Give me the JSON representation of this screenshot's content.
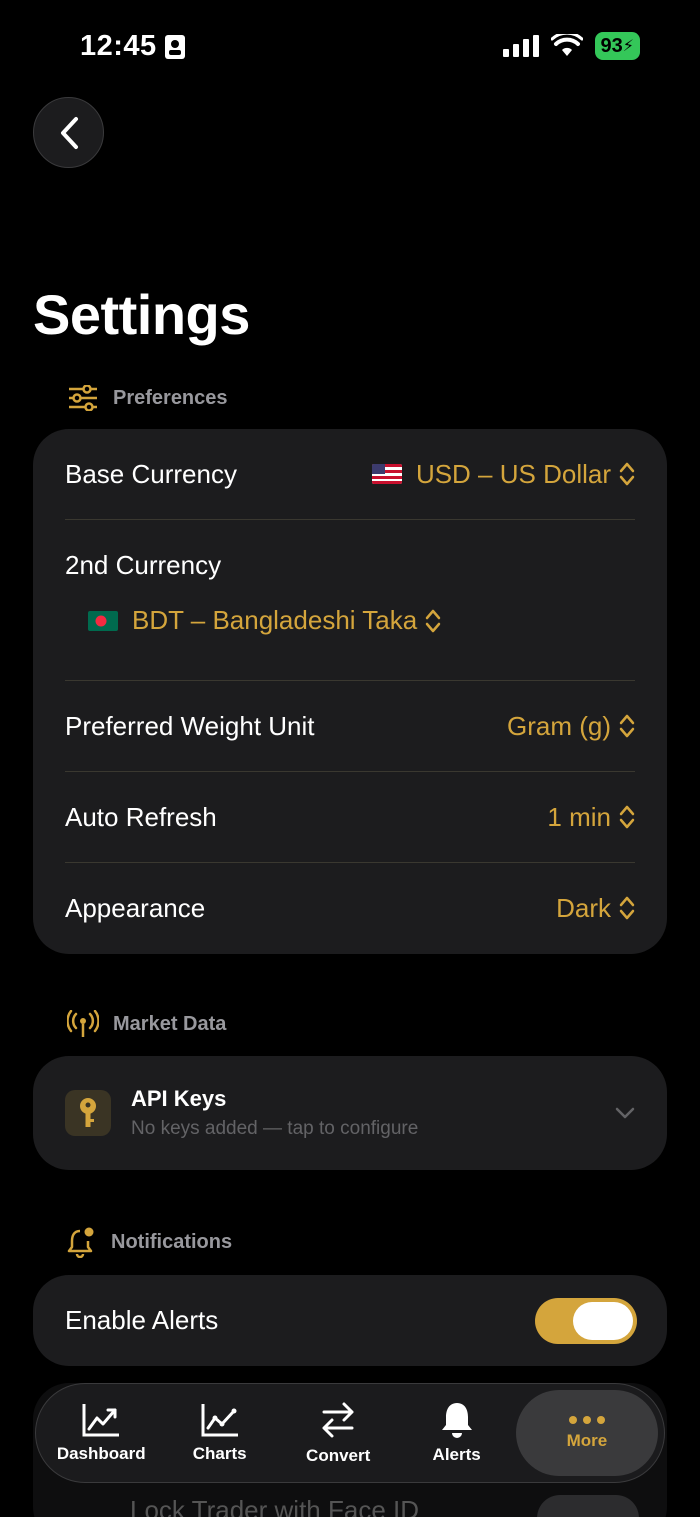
{
  "status": {
    "time": "12:45",
    "battery": "93"
  },
  "page": {
    "title": "Settings"
  },
  "sections": {
    "preferences": "Preferences",
    "market_data": "Market Data",
    "notifications": "Notifications"
  },
  "preferences": {
    "base_currency_label": "Base Currency",
    "base_currency_value": "USD – US Dollar",
    "second_currency_label": "2nd Currency",
    "second_currency_value": "BDT – Bangladeshi Taka",
    "weight_label": "Preferred Weight Unit",
    "weight_value": "Gram (g)",
    "refresh_label": "Auto Refresh",
    "refresh_value": "1 min",
    "appearance_label": "Appearance",
    "appearance_value": "Dark"
  },
  "market": {
    "api_title": "API Keys",
    "api_subtitle": "No keys added — tap to configure"
  },
  "notifications": {
    "enable_label": "Enable Alerts",
    "enabled": true
  },
  "behind": {
    "lock_label": "Lock Trader with Face ID"
  },
  "tabs": [
    {
      "label": "Dashboard",
      "icon": "chart-up-icon"
    },
    {
      "label": "Charts",
      "icon": "line-chart-icon"
    },
    {
      "label": "Convert",
      "icon": "arrows-swap-icon"
    },
    {
      "label": "Alerts",
      "icon": "bell-icon"
    },
    {
      "label": "More",
      "icon": "ellipsis-icon"
    }
  ],
  "colors": {
    "accent": "#d4a53c",
    "card": "#1c1c1e",
    "background": "#000000"
  }
}
